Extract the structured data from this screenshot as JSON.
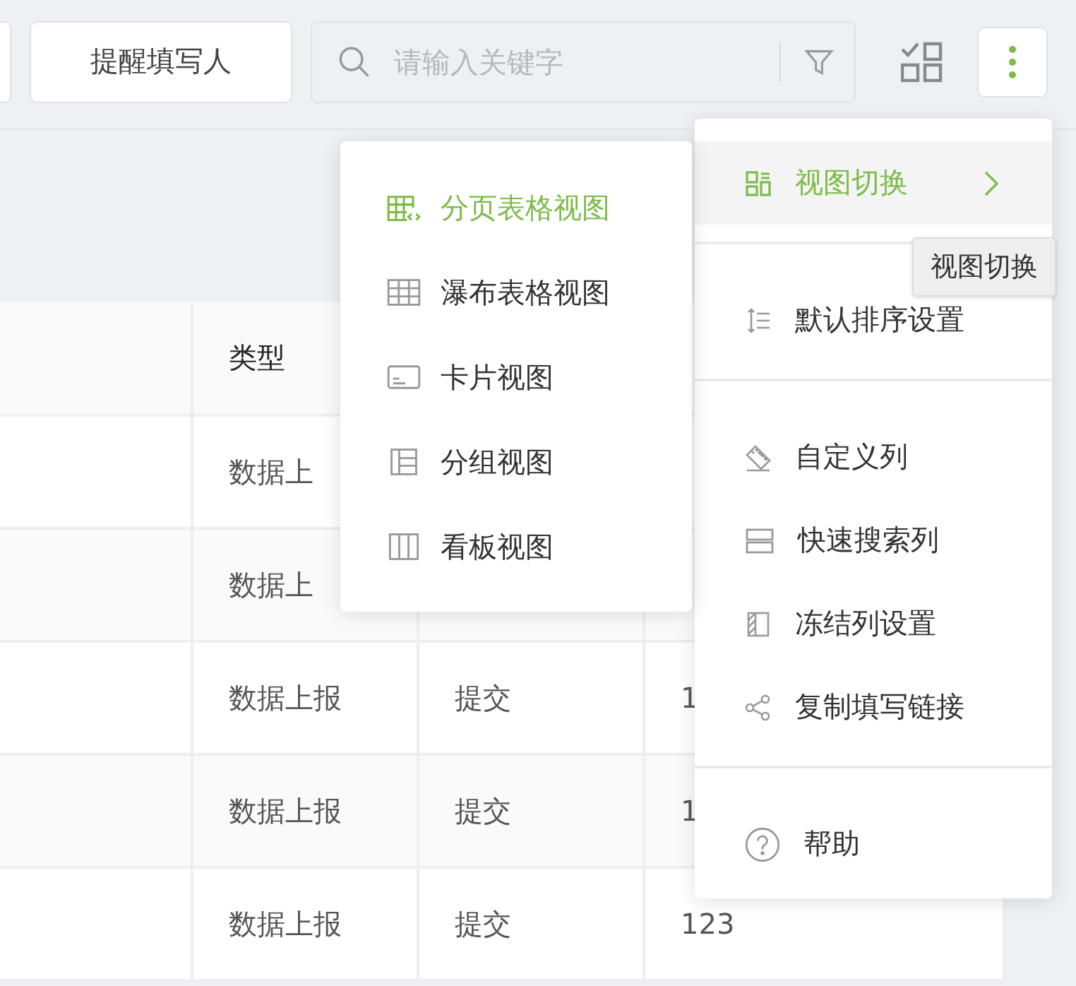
{
  "toolbar": {
    "remind_button": "提醒填写人",
    "search": {
      "placeholder": "请输入关键字"
    }
  },
  "table": {
    "header": {
      "column_2": "类型"
    },
    "rows": [
      {
        "column_2": "数据上"
      },
      {
        "column_2": "数据上"
      },
      {
        "column_2": "数据上报",
        "column_3": "提交",
        "column_4": "1"
      },
      {
        "column_2": "数据上报",
        "column_3": "提交",
        "column_4": "1"
      },
      {
        "column_2": "数据上报",
        "column_3": "提交",
        "column_4": "123"
      }
    ]
  },
  "menu": {
    "sections": [
      [
        {
          "label": "视图切换",
          "kind": "view",
          "selected": true,
          "has_submenu": true
        }
      ],
      [
        {
          "label": "默认排序设置",
          "kind": "sort",
          "selected": false
        }
      ],
      [
        {
          "label": "自定义列",
          "kind": "ruler",
          "selected": false
        },
        {
          "label": "快速搜索列",
          "kind": "rows",
          "selected": false
        },
        {
          "label": "冻结列设置",
          "kind": "freeze",
          "selected": false
        },
        {
          "label": "复制填写链接",
          "kind": "share",
          "selected": false
        }
      ],
      [
        {
          "label": "帮助",
          "kind": "help",
          "selected": false
        }
      ]
    ]
  },
  "tooltip": "视图切换",
  "submenu": {
    "items": [
      {
        "label": "分页表格视图",
        "kind": "paged",
        "selected": true
      },
      {
        "label": "瀑布表格视图",
        "kind": "grid",
        "selected": false
      },
      {
        "label": "卡片视图",
        "kind": "card",
        "selected": false
      },
      {
        "label": "分组视图",
        "kind": "group",
        "selected": false
      },
      {
        "label": "看板视图",
        "kind": "kanban",
        "selected": false
      }
    ]
  }
}
